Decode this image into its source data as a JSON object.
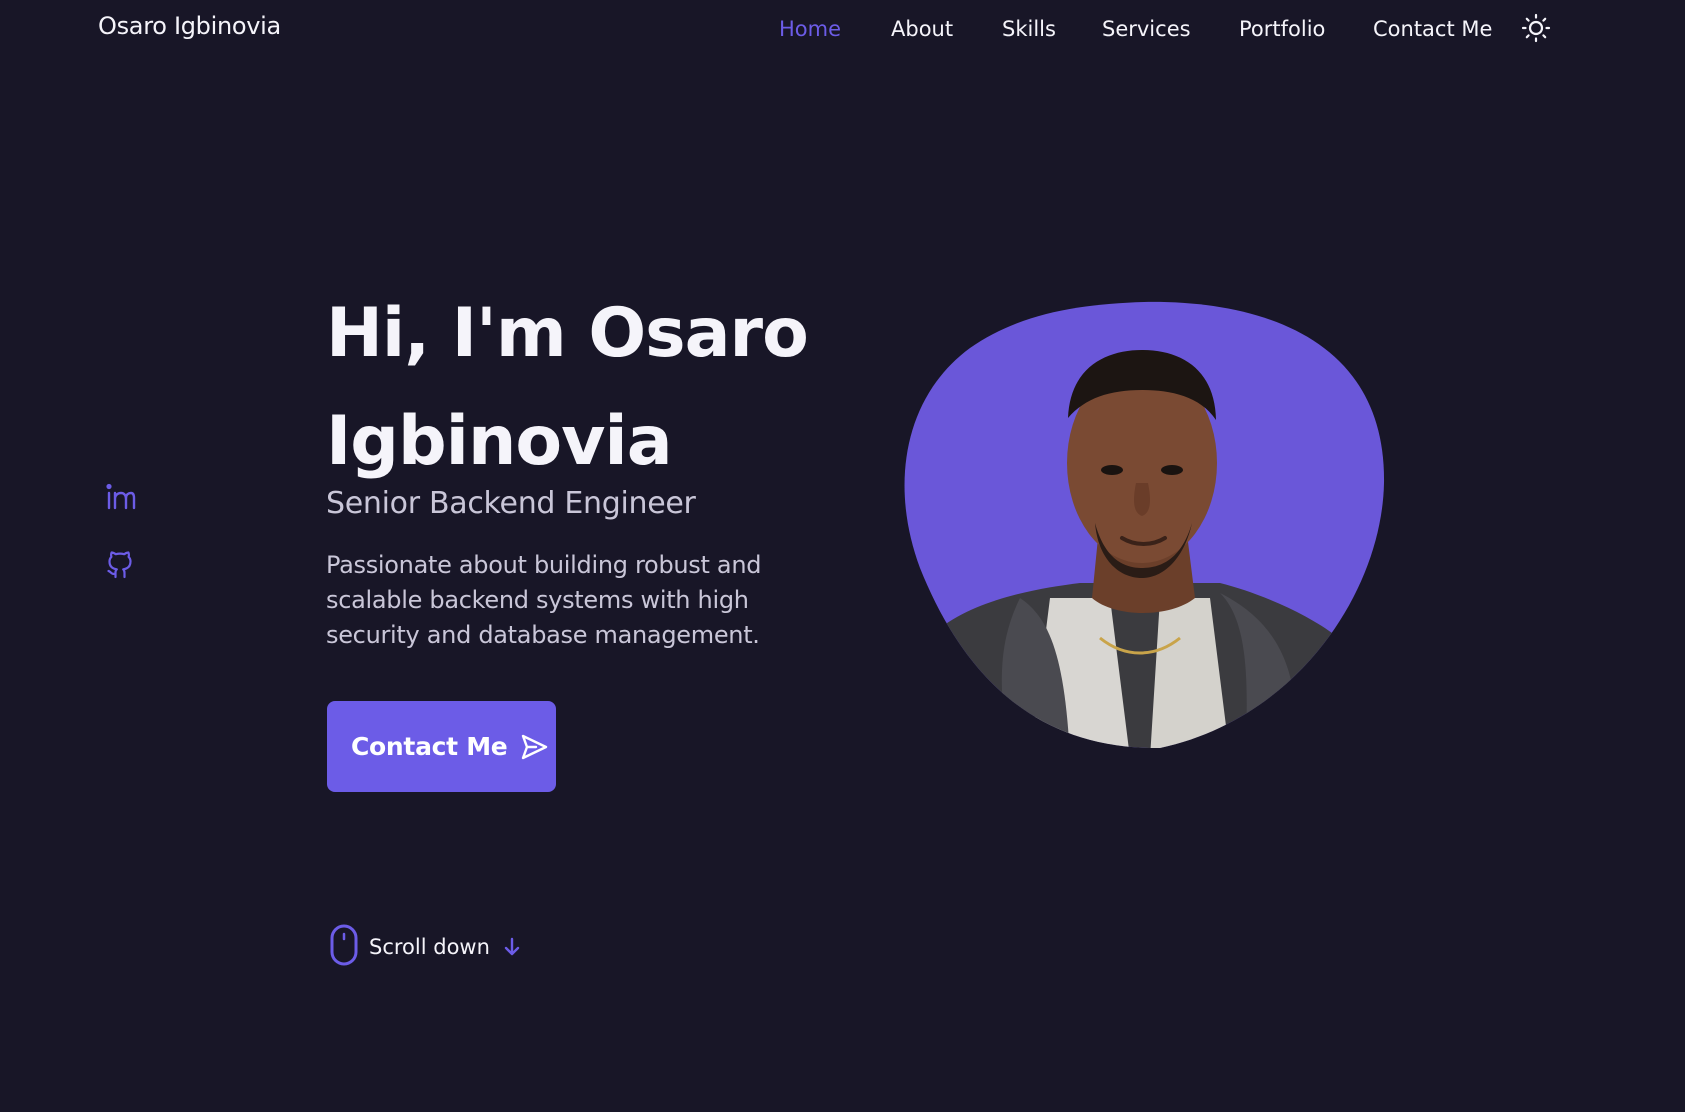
{
  "header": {
    "logo": "Osaro Igbinovia",
    "nav": [
      {
        "label": "Home",
        "active": true
      },
      {
        "label": "About",
        "active": false
      },
      {
        "label": "Skills",
        "active": false
      },
      {
        "label": "Services",
        "active": false
      },
      {
        "label": "Portfolio",
        "active": false
      },
      {
        "label": "Contact Me",
        "active": false
      }
    ],
    "theme_toggle_icon": "sun-icon"
  },
  "social": [
    {
      "icon": "linkedin-icon"
    },
    {
      "icon": "github-icon"
    }
  ],
  "hero": {
    "title_line1": "Hi, I'm Osaro",
    "title_line2": "Igbinovia",
    "subtitle": "Senior Backend Engineer",
    "description": "Passionate about building robust and scalable backend systems with high security and database management.",
    "cta_label": "Contact Me",
    "cta_icon": "send-icon"
  },
  "scroll": {
    "label": "Scroll down",
    "icon": "mouse-icon",
    "arrow_icon": "arrow-down-icon"
  },
  "portrait": {
    "alt_icon": "profile-photo"
  },
  "colors": {
    "background": "#181627",
    "accent": "#6c5ce7",
    "text": "#f5f4fa",
    "muted": "#c9c6d8"
  }
}
